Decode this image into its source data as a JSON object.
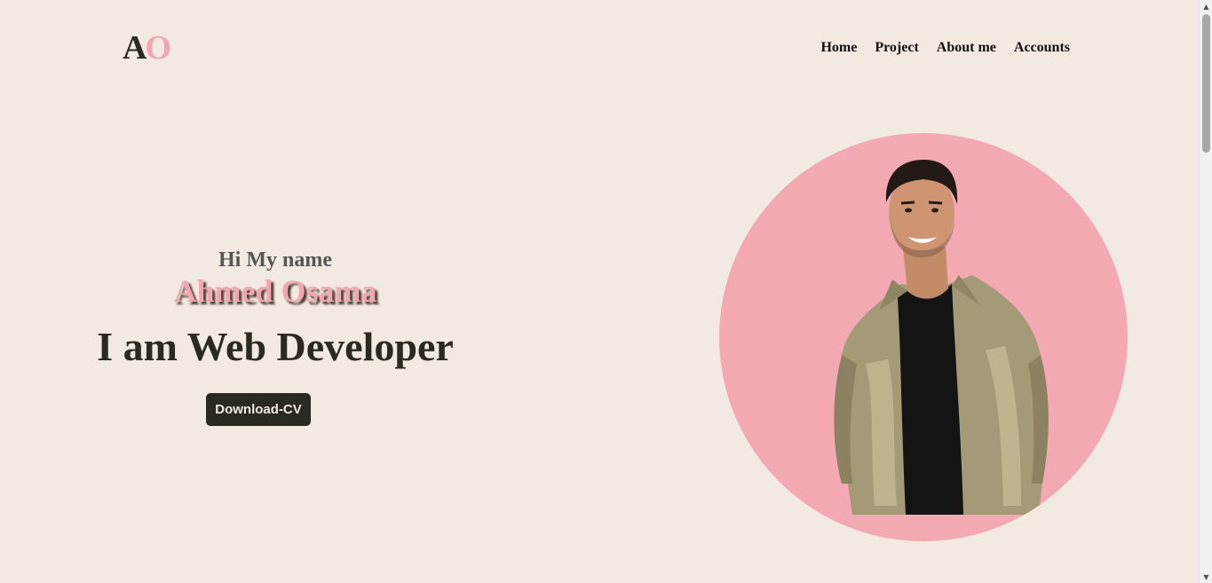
{
  "brand": {
    "logo_first": "A",
    "logo_second": "O",
    "logo_colors": [
      "#2b2a20",
      "#f2a7b0"
    ]
  },
  "nav": {
    "items": [
      {
        "label": "Home"
      },
      {
        "label": "Project"
      },
      {
        "label": "About me"
      },
      {
        "label": "Accounts"
      }
    ]
  },
  "hero": {
    "greeting": "Hi My name",
    "name": "Ahmed Osama",
    "role": "I am Web Developer",
    "cta_label": "Download-CV",
    "portrait_icon": "portrait-photo",
    "accent_color": "#f2a9b2"
  },
  "scrollbar": {
    "up_icon": "scroll-up-arrow-icon",
    "down_icon": "scroll-down-arrow-icon"
  }
}
